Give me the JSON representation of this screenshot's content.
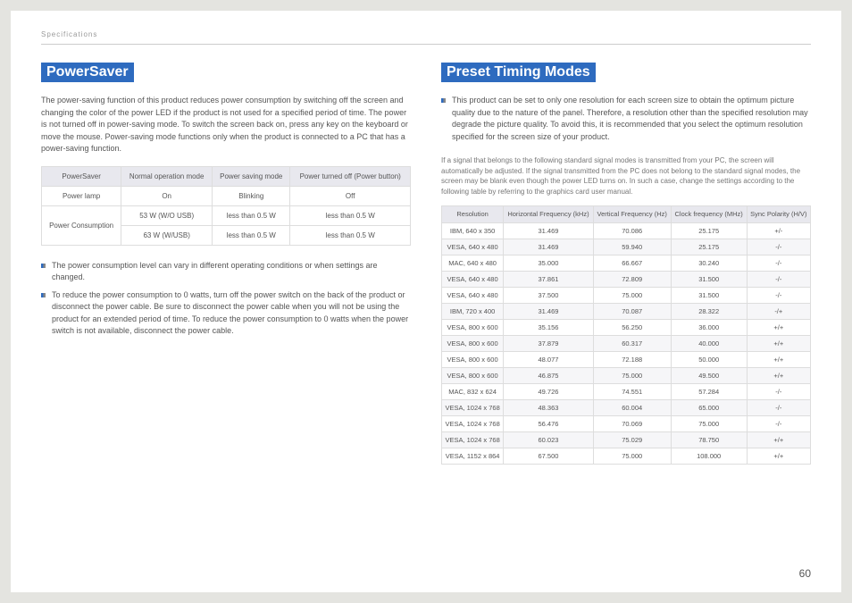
{
  "breadcrumb": "Specifications",
  "page_number": "60",
  "left": {
    "title": "PowerSaver",
    "intro": "The power-saving function of this product reduces power consumption by switching off the screen and changing the color of the power LED if the product is not used for a specified period of time. The power is not turned off in power-saving mode. To switch the screen back on, press any key on the keyboard or move the mouse. Power-saving mode functions only when the product is connected to a PC that has a power-saving function.",
    "table": {
      "headers": [
        "PowerSaver",
        "Normal operation mode",
        "Power saving mode",
        "Power turned off (Power button)"
      ],
      "rows": [
        [
          "Power lamp",
          "On",
          "Blinking",
          "Off"
        ],
        [
          "__ROWSPAN__Power Consumption",
          "53 W (W/O USB)",
          "less than 0.5 W",
          "less than 0.5 W"
        ],
        [
          "",
          "63 W (W/USB)",
          "less than 0.5 W",
          "less than 0.5 W"
        ]
      ]
    },
    "notes": [
      "The power consumption level can vary in different operating conditions or when settings are changed.",
      "To reduce the power consumption to 0 watts, turn off the power switch on the back of the product or disconnect the power cable. Be sure to disconnect the power cable when you will not be using the product for an extended period of time. To reduce the power consumption to 0 watts when the power switch is not available, disconnect the power cable."
    ]
  },
  "right": {
    "title": "Preset Timing Modes",
    "intro_bullet": "This product can be set to only one resolution for each screen size to obtain the optimum picture quality due to the nature of the panel. Therefore, a resolution other than the specified resolution may degrade the picture quality. To avoid this, it is recommended that you select the optimum resolution specified for the screen size of your product.",
    "small_para": "If a signal that belongs to the following standard signal modes is transmitted from your PC, the screen will automatically be adjusted. If the signal transmitted from the PC does not belong to the standard signal modes, the screen may be blank even though the power LED turns on. In such a case, change the settings according to the following table by referring to the graphics card user manual.",
    "timing": {
      "headers": [
        "Resolution",
        "Horizontal Frequency (kHz)",
        "Vertical Frequency (Hz)",
        "Clock frequency (MHz)",
        "Sync Polarity (H/V)"
      ],
      "rows": [
        [
          "IBM, 640 x 350",
          "31.469",
          "70.086",
          "25.175",
          "+/-"
        ],
        [
          "VESA, 640 x 480",
          "31.469",
          "59.940",
          "25.175",
          "-/-"
        ],
        [
          "MAC, 640 x 480",
          "35.000",
          "66.667",
          "30.240",
          "-/-"
        ],
        [
          "VESA, 640 x 480",
          "37.861",
          "72.809",
          "31.500",
          "-/-"
        ],
        [
          "VESA, 640 x 480",
          "37.500",
          "75.000",
          "31.500",
          "-/-"
        ],
        [
          "IBM, 720 x 400",
          "31.469",
          "70.087",
          "28.322",
          "-/+"
        ],
        [
          "VESA, 800 x 600",
          "35.156",
          "56.250",
          "36.000",
          "+/+"
        ],
        [
          "VESA, 800 x 600",
          "37.879",
          "60.317",
          "40.000",
          "+/+"
        ],
        [
          "VESA, 800 x 600",
          "48.077",
          "72.188",
          "50.000",
          "+/+"
        ],
        [
          "VESA, 800 x 600",
          "46.875",
          "75.000",
          "49.500",
          "+/+"
        ],
        [
          "MAC, 832 x 624",
          "49.726",
          "74.551",
          "57.284",
          "-/-"
        ],
        [
          "VESA, 1024 x 768",
          "48.363",
          "60.004",
          "65.000",
          "-/-"
        ],
        [
          "VESA, 1024 x 768",
          "56.476",
          "70.069",
          "75.000",
          "-/-"
        ],
        [
          "VESA, 1024 x 768",
          "60.023",
          "75.029",
          "78.750",
          "+/+"
        ],
        [
          "VESA, 1152 x 864",
          "67.500",
          "75.000",
          "108.000",
          "+/+"
        ]
      ]
    }
  }
}
